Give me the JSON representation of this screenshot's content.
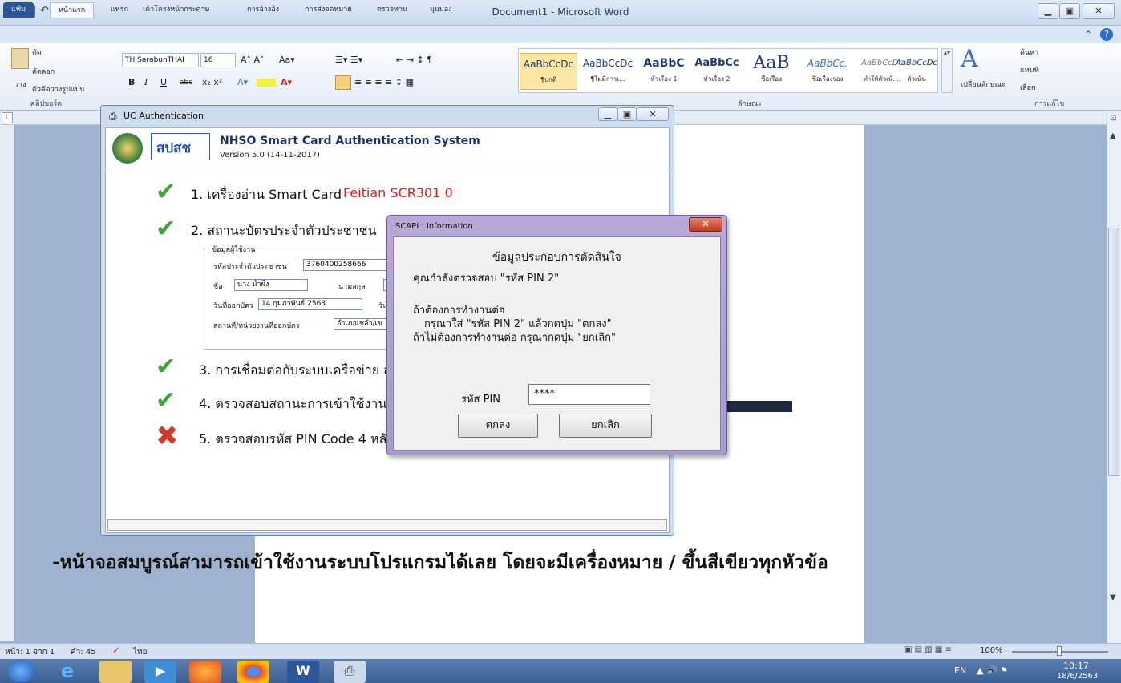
{
  "word": {
    "title": "Document1 - Microsoft Word",
    "tabs": [
      "แฟ้ม",
      "หน้าแรก",
      "แทรก",
      "เค้าโครงหน้ากระดาษ",
      "การอ้างอิง",
      "การส่งจดหมาย",
      "ตรวจทาน",
      "มุมมอง"
    ],
    "clipboard": {
      "cut": "ตัด",
      "copy": "คัดลอก",
      "paste": "วาง",
      "format_painter": "ตัวคัดวางรูปแบบ",
      "group": "คลิปบอร์ด"
    },
    "font": {
      "name": "TH SarabunTHAI",
      "size": "16"
    },
    "styles": [
      {
        "preview": "AaBbCcDc",
        "name": "¶ปกติ"
      },
      {
        "preview": "AaBbCcDc",
        "name": "¶ไม่มีการเ..."
      },
      {
        "preview": "AaBbC",
        "name": "หัวเรื่อง 1"
      },
      {
        "preview": "AaBbCc",
        "name": "หัวเรื่อง 2"
      },
      {
        "preview": "AaB",
        "name": "ชื่อเรื่อง"
      },
      {
        "preview": "AaBbCc.",
        "name": "ชื่อเรื่องรอง"
      },
      {
        "preview": "AaBbCcDc",
        "name": "ทำให้ตัวเน้...."
      },
      {
        "preview": "AaBbCcDc",
        "name": "ตัวเน้น"
      }
    ],
    "styles_group": "ลักษณะ",
    "change_styles": "เปลี่ยนลักษณะ",
    "editing": {
      "find": "ค้นหา",
      "replace": "แทนที่",
      "select": "เลือก",
      "group": "การแก้ไข"
    },
    "status": {
      "page": "หน้า: 1 จาก 1",
      "words": "คำ: 45",
      "lang": "ไทย",
      "zoom": "100%"
    },
    "taskbar": {
      "lang": "EN",
      "time": "10:17",
      "date": "18/6/2563"
    }
  },
  "uc": {
    "window_title": "UC Authentication",
    "logo_text": "สปสช",
    "system_name": "NHSO Smart Card  Authentication System",
    "version": "Version 5.0 (14-11-2017)",
    "step1_label": "1. เครื่องอ่าน Smart Card",
    "step1_reader": "Feitian SCR301 0",
    "step2_label": "2. สถานะบัตรประจำตัวประชาชน",
    "group_title": "ข้อมูลผู้ใช้งาน",
    "id_label": "รหัสประจำตัวประชาชน",
    "id_value": "3760400258666",
    "name_label": "ชื่อ",
    "name_value": "นาง น้ำผึ้ง",
    "surname_label": "นามสกุล",
    "issue_label": "วันที่ออกบัตร",
    "issue_value": "14 กุมภาพันธ์ 2563",
    "issue_next_label": "วัน",
    "place_label": "สถานที่/หน่วยงานที่ออกบัตร",
    "place_value": "อำเภอเชลำ/เข",
    "step3_label": "3. การเชื่อมต่อกับระบบเครือข่าย สป",
    "step4_label": "4. ตรวจสอบสถานะการเข้าใช้งานระ",
    "step5_label": "5. ตรวจสอบรหัส PIN Code 4 หลัก"
  },
  "scapi": {
    "title": "SCAPI : Information",
    "heading": "ข้อมูลประกอบการตัดสินใจ",
    "line1": "คุณกำลังตรวจสอบ \"รหัส PIN 2\"",
    "line2": "ถ้าต้องการทำงานต่อ",
    "line3": "กรุณาใส่ \"รหัส PIN 2\" แล้วกดปุ่ม \"ตกลง\"",
    "line4": "ถ้าไม่ต้องการทำงานต่อ กรุณากดปุ่ม \"ยกเลิก\"",
    "pin_label": "รหัส PIN",
    "pin_value": "****",
    "ok_label": "ตกลง",
    "cancel_label": "ยกเลิก"
  },
  "caption": "-หน้าจอสมบูรณ์สามารถเข้าใช้งานระบบโปรแกรมได้เลย โดยจะมีเครื่องหมาย / ขึ้นสีเขียวทุกหัวข้อ",
  "colors": {
    "check": "#3aa63a",
    "cross": "#d23a2a",
    "reader": "#e01818",
    "file_tab": "#2b579a"
  }
}
